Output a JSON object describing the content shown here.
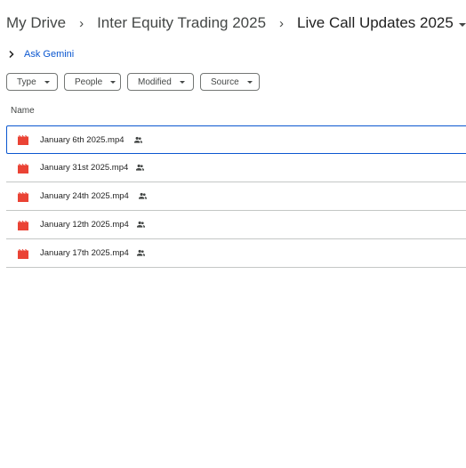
{
  "breadcrumb": {
    "items": [
      "My Drive",
      "Inter Equity Trading 2025",
      "Live Call Updates 2025"
    ],
    "separator": "›"
  },
  "gemini": {
    "label": "Ask Gemini"
  },
  "filters": {
    "type": "Type",
    "people": "People",
    "modified": "Modified",
    "source": "Source"
  },
  "table": {
    "column_name": "Name",
    "files": [
      {
        "name": "January 6th 2025.mp4",
        "shared": true,
        "selected": true
      },
      {
        "name": "January 31st 2025.mp4",
        "shared": true,
        "selected": false
      },
      {
        "name": "January 24th 2025.mp4",
        "shared": true,
        "selected": false
      },
      {
        "name": "January 12th 2025.mp4",
        "shared": true,
        "selected": false
      },
      {
        "name": "January 17th 2025.mp4",
        "shared": true,
        "selected": false
      }
    ]
  },
  "colors": {
    "accent": "#0b57d0",
    "video_icon": "#ea4335",
    "border": "#c4c7c5"
  },
  "icons": {
    "file": "video-file-icon",
    "shared": "people-icon",
    "folder_share": "people-icon",
    "gemini": "chevron-right-icon"
  }
}
